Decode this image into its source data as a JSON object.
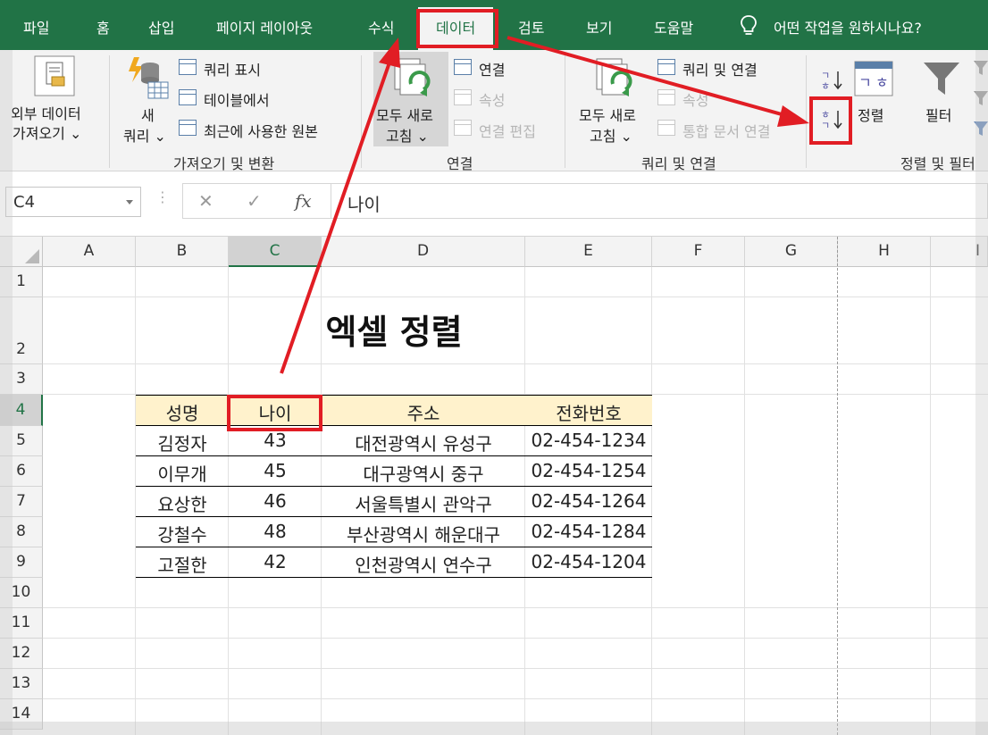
{
  "ribbon_tabs": [
    "파일",
    "홈",
    "삽입",
    "페이지 레이아웃",
    "수식",
    "데이터",
    "검토",
    "보기",
    "도움말"
  ],
  "active_tab": "데이터",
  "tell_me": "어떤 작업을 원하시나요?",
  "ribbon": {
    "external_data": {
      "line1": "외부 데이터",
      "line2": "가져오기 ⌄"
    },
    "new_query": {
      "line1": "새",
      "line2": "쿼리 ⌄"
    },
    "show_queries": "쿼리 표시",
    "from_table": "테이블에서",
    "recent_sources": "최근에 사용한 원본",
    "group_get_transform": "가져오기 및 변환",
    "refresh_all": {
      "line1": "모두 새로",
      "line2": "고침 ⌄"
    },
    "connections": "연결",
    "properties": "속성",
    "edit_links": "연결 편집",
    "group_connections": "연결",
    "refresh_all2": {
      "line1": "모두 새로",
      "line2": "고침 ⌄"
    },
    "queries_connections": "쿼리 및 연결",
    "properties2": "속성",
    "edit_links2": "통합 문서 연결",
    "group_queries": "쿼리 및 연결",
    "sort_asc_glyph": "ㄱ",
    "sort_desc_glyph": "ㅎ",
    "sort_label": "정렬",
    "filter_label": "필터",
    "group_sort_filter": "정렬 및 필터"
  },
  "formula_bar": {
    "name_box": "C4",
    "cancel": "✕",
    "enter": "✓",
    "fx": "fx",
    "value": "나이"
  },
  "columns": [
    "A",
    "B",
    "C",
    "D",
    "E",
    "F",
    "G",
    "H",
    "I"
  ],
  "rows": [
    "1",
    "2",
    "3",
    "4",
    "5",
    "6",
    "7",
    "8",
    "9",
    "10",
    "11",
    "12",
    "13",
    "14"
  ],
  "sheet": {
    "title": "엑셀 정렬",
    "headers": [
      "성명",
      "나이",
      "주소",
      "전화번호"
    ],
    "data": [
      [
        "김정자",
        "43",
        "대전광역시 유성구",
        "02-454-1234"
      ],
      [
        "이무개",
        "45",
        "대구광역시 중구",
        "02-454-1254"
      ],
      [
        "요상한",
        "46",
        "서울특별시 관악구",
        "02-454-1264"
      ],
      [
        "강철수",
        "48",
        "부산광역시 해운대구",
        "02-454-1284"
      ],
      [
        "고절한",
        "42",
        "인천광역시 연수구",
        "02-454-1204"
      ]
    ]
  },
  "colors": {
    "ribbon_green": "#217346",
    "header_fill": "#fff2cc",
    "annotation_red": "#e11d24"
  }
}
